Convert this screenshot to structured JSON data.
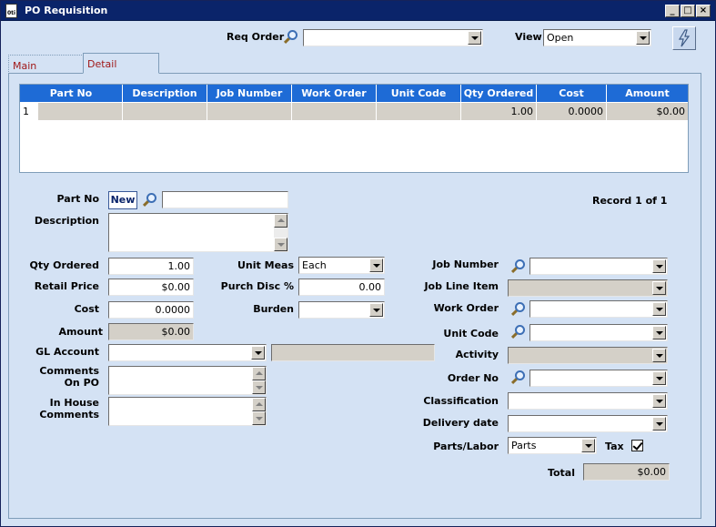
{
  "window": {
    "title": "PO Requisition",
    "icon_text": "0ti"
  },
  "titlebar_buttons": {
    "minimize": "_",
    "maximize": "□",
    "close": "×"
  },
  "header": {
    "req_order_label": "Req Order",
    "req_order_value": "",
    "view_label": "View",
    "view_value": "Open"
  },
  "tabs": [
    {
      "label": "Main",
      "active": false
    },
    {
      "label": "Detail",
      "active": true
    }
  ],
  "grid": {
    "columns": [
      "Part No",
      "Description",
      "Job Number",
      "Work Order",
      "Unit Code",
      "Qty Ordered",
      "Cost",
      "Amount"
    ],
    "rows": [
      [
        "1",
        "",
        "",
        "",
        "",
        "1.00",
        "0.0000",
        "$0.00"
      ]
    ]
  },
  "form": {
    "part_no_label": "Part No",
    "new_button": "New",
    "part_no_value": "",
    "record_status": "Record 1 of 1",
    "description_label": "Description",
    "qty_ordered_label": "Qty Ordered",
    "qty_ordered_value": "1.00",
    "retail_price_label": "Retail Price",
    "retail_price_value": "$0.00",
    "cost_label": "Cost",
    "cost_value": "0.0000",
    "amount_label": "Amount",
    "amount_value": "$0.00",
    "gl_account_label": "GL Account",
    "comments_on_po_label1": "Comments",
    "comments_on_po_label2": "On PO",
    "in_house_label1": "In House",
    "in_house_label2": "Comments",
    "unit_meas_label": "Unit Meas",
    "unit_meas_value": "Each",
    "purch_disc_label": "Purch Disc %",
    "purch_disc_value": "0.00",
    "burden_label": "Burden",
    "job_number_label": "Job Number",
    "job_line_item_label": "Job Line Item",
    "work_order_label": "Work Order",
    "unit_code_label": "Unit Code",
    "activity_label": "Activity",
    "order_no_label": "Order No",
    "classification_label": "Classification",
    "delivery_date_label": "Delivery date",
    "parts_labor_label": "Parts/Labor",
    "parts_labor_value": "Parts",
    "tax_label": "Tax",
    "tax_checked": true,
    "total_label": "Total",
    "total_value": "$0.00"
  }
}
